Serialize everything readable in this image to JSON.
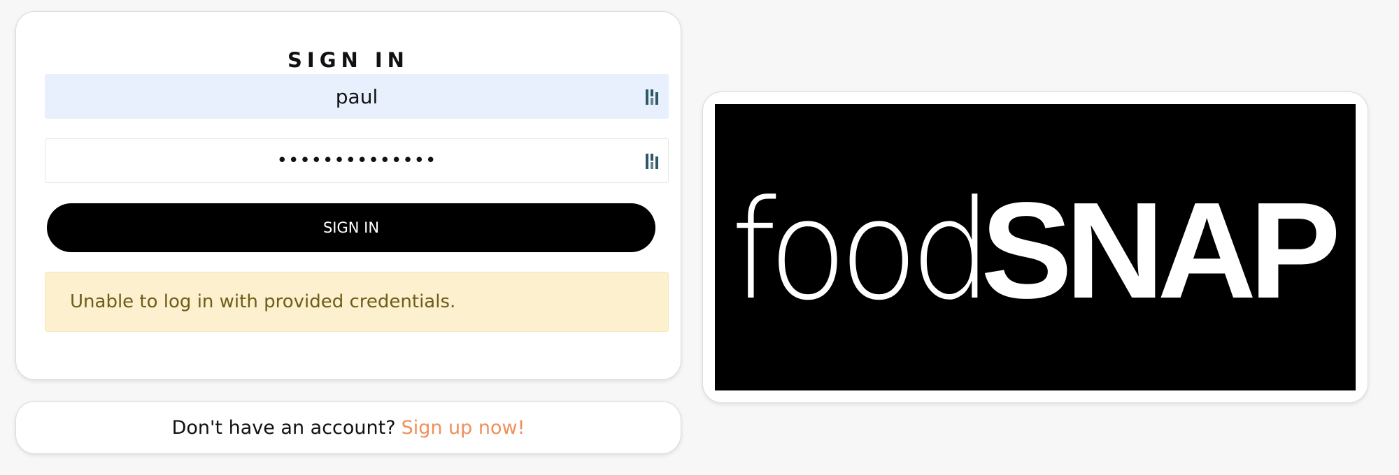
{
  "signin": {
    "title": "SIGN IN",
    "username": {
      "value": "paul",
      "icon": "password-manager-icon"
    },
    "password": {
      "value": "••••••••••••••",
      "icon": "password-manager-icon"
    },
    "submit_label": "SIGN IN",
    "error_message": "Unable to log in with provided credentials."
  },
  "signup": {
    "prompt": "Don't have an account?",
    "link": "Sign up now!"
  },
  "logo": {
    "text_light": "food",
    "text_bold": "SNAP"
  },
  "colors": {
    "background": "#f7f7f7",
    "autofill": "#e8f0fe",
    "button": "#000000",
    "alert_bg": "#fcf0cf",
    "alert_text": "#6e5c18",
    "link": "#ef8f5c"
  }
}
